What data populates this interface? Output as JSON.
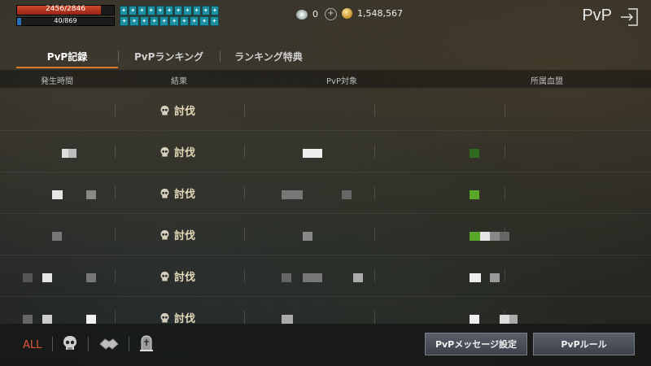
{
  "hud": {
    "hp_text": "2456/2846",
    "hp_fraction": 0.863,
    "mp_text": "40/869",
    "mp_fraction": 0.046,
    "buff_icon_rows": [
      [
        "buff",
        "buff",
        "buff",
        "buff",
        "buff",
        "buff",
        "buff",
        "buff",
        "buff",
        "buff",
        "buff"
      ],
      [
        "buff",
        "buff",
        "buff",
        "buff",
        "buff",
        "buff",
        "buff",
        "buff",
        "buff",
        "buff"
      ]
    ]
  },
  "currency": {
    "gem_count": "0",
    "gold_count": "1,548,567"
  },
  "header": {
    "title": "PvP"
  },
  "tabs": [
    {
      "label": "PvP記録",
      "active": true
    },
    {
      "label": "PvPランキング",
      "active": false
    },
    {
      "label": "ランキング特典",
      "active": false
    }
  ],
  "columns": {
    "time": "発生時間",
    "result": "結果",
    "target": "PvP対象",
    "clan": "所属血盟"
  },
  "rows": [
    {
      "result": "討伐"
    },
    {
      "result": "討伐"
    },
    {
      "result": "討伐"
    },
    {
      "result": "討伐"
    },
    {
      "result": "討伐"
    },
    {
      "result": "討伐"
    }
  ],
  "filter": {
    "all_label": "ALL"
  },
  "buttons": {
    "message_settings": "PvPメッセージ設定",
    "rules": "PvPルール"
  },
  "colors": {
    "accent_orange": "#d9792e",
    "all_red": "#e0573b",
    "result_text": "#e3d9b8",
    "clan_green": "#5aa829"
  }
}
